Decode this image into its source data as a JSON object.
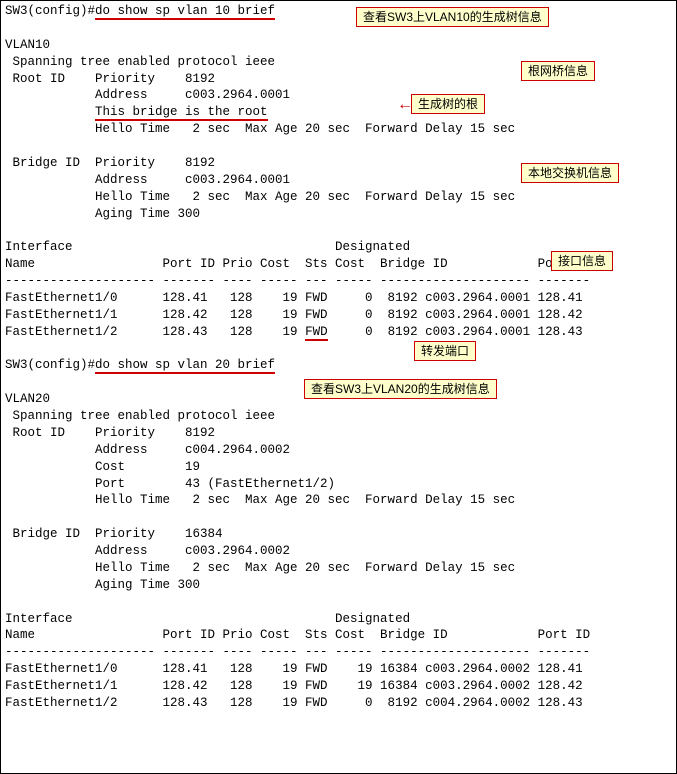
{
  "labels": {
    "view_vlan10": "查看SW3上VLAN10的生成树信息",
    "root_bridge_info": "根网桥信息",
    "root_of_tree": "生成树的根",
    "local_switch_info": "本地交换机信息",
    "interface_info": "接口信息",
    "forward_port": "转发端口",
    "view_vlan20": "查看SW3上VLAN20的生成树信息"
  },
  "cmd1_prefix": "SW3(config)#",
  "cmd1_cmd": "do show sp vlan 10 brief",
  "vlan10": {
    "name": "VLAN10",
    "proto": " Spanning tree enabled protocol ieee",
    "root": {
      "priority_line": " Root ID    Priority    8192",
      "address_line": "            Address     c003.2964.0001",
      "this_bridge_prefix": "            ",
      "this_bridge_text": "This bridge is the root",
      "hello_line": "            Hello Time   2 sec  Max Age 20 sec  Forward Delay 15 sec"
    },
    "bridge": {
      "priority_line": " Bridge ID  Priority    8192",
      "address_line": "            Address     c003.2964.0001",
      "hello_line": "            Hello Time   2 sec  Max Age 20 sec  Forward Delay 15 sec",
      "aging_line": "            Aging Time 300"
    },
    "table": {
      "hdr1": "Interface                                   Designated",
      "hdr2": "Name                 Port ID Prio Cost  Sts Cost  Bridge ID            Port ID",
      "sep": "-------------------- ------- ---- ----- --- ----- -------------------- -------",
      "rows": [
        "FastEthernet1/0      128.41   128    19 FWD     0  8192 c003.2964.0001 128.41",
        "FastEthernet1/1      128.42   128    19 FWD     0  8192 c003.2964.0001 128.42",
        "FastEthernet1/2      128.43   128    19 FWD     0  8192 c003.2964.0001 128.43"
      ],
      "row2_prefix": "FastEthernet1/2      128.43   128    19 ",
      "row2_fwd": "FWD",
      "row2_suffix": "     0  8192 c003.2964.0001 128.43"
    }
  },
  "cmd2_prefix": "SW3(config)#",
  "cmd2_cmd": "do show sp vlan 20 brief",
  "vlan20": {
    "name": "VLAN20",
    "proto": " Spanning tree enabled protocol ieee",
    "root": {
      "priority_line": " Root ID    Priority    8192",
      "address_line": "            Address     c004.2964.0002",
      "cost_line": "            Cost        19",
      "port_line": "            Port        43 (FastEthernet1/2)",
      "hello_line": "            Hello Time   2 sec  Max Age 20 sec  Forward Delay 15 sec"
    },
    "bridge": {
      "priority_line": " Bridge ID  Priority    16384",
      "address_line": "            Address     c003.2964.0002",
      "hello_line": "            Hello Time   2 sec  Max Age 20 sec  Forward Delay 15 sec",
      "aging_line": "            Aging Time 300"
    },
    "table": {
      "hdr1": "Interface                                   Designated",
      "hdr2": "Name                 Port ID Prio Cost  Sts Cost  Bridge ID            Port ID",
      "sep": "-------------------- ------- ---- ----- --- ----- -------------------- -------",
      "rows": [
        "FastEthernet1/0      128.41   128    19 FWD    19 16384 c003.2964.0002 128.41",
        "FastEthernet1/1      128.42   128    19 FWD    19 16384 c003.2964.0002 128.42",
        "FastEthernet1/2      128.43   128    19 FWD     0  8192 c004.2964.0002 128.43"
      ]
    }
  }
}
